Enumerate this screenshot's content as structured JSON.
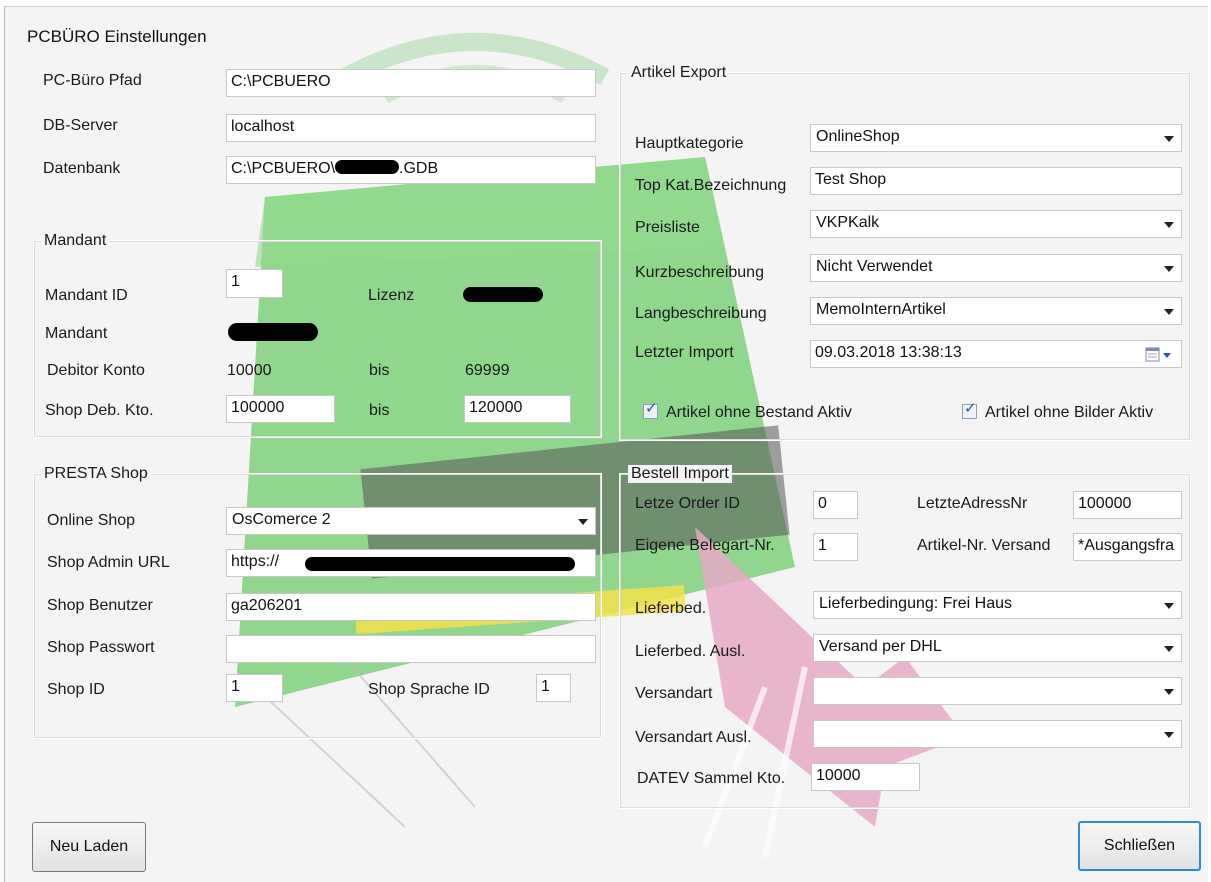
{
  "window": {
    "title": "PCBÜRO Einstellungen"
  },
  "paths": {
    "pcbuero_pfad_label": "PC-Büro Pfad",
    "pcbuero_pfad_value": "C:\\PCBUERO",
    "db_server_label": "DB-Server",
    "db_server_value": "localhost",
    "datenbank_label": "Datenbank",
    "datenbank_value_prefix": "C:\\PCBUERO\\",
    "datenbank_value_suffix": ".GDB"
  },
  "mandant": {
    "legend": "Mandant",
    "id_label": "Mandant ID",
    "id_value": "1",
    "lizenz_label": "Lizenz",
    "mandant_label": "Mandant",
    "debitor_label": "Debitor Konto",
    "debitor_from": "10000",
    "debitor_bis": "bis",
    "debitor_to": "69999",
    "shop_deb_label": "Shop Deb. Kto.",
    "shop_deb_from": "100000",
    "shop_deb_bis": "bis",
    "shop_deb_to": "120000"
  },
  "presta": {
    "legend": "PRESTA Shop",
    "online_shop_label": "Online Shop",
    "online_shop_value": "OsComerce 2",
    "admin_url_label": "Shop Admin URL",
    "admin_url_value": "https://",
    "benutzer_label": "Shop Benutzer",
    "benutzer_value": "ga206201",
    "passwort_label": "Shop Passwort",
    "passwort_value": "",
    "shop_id_label": "Shop ID",
    "shop_id_value": "1",
    "sprache_label": "Shop Sprache ID",
    "sprache_value": "1"
  },
  "export": {
    "legend": "Artikel Export",
    "hauptkategorie_label": "Hauptkategorie",
    "hauptkategorie_value": "OnlineShop",
    "topkat_label": "Top Kat.Bezeichnung",
    "topkat_value": "Test Shop",
    "preisliste_label": "Preisliste",
    "preisliste_value": "VKPKalk",
    "kurz_label": "Kurzbeschreibung",
    "kurz_value": "Nicht Verwendet",
    "lang_label": "Langbeschreibung",
    "lang_value": "MemoInternArtikel",
    "letzter_import_label": "Letzter Import",
    "letzter_import_value": "09.03.2018 13:38:13",
    "chk_bestand_label": "Artikel ohne Bestand Aktiv",
    "chk_bestand_checked": true,
    "chk_bilder_label": "Artikel ohne Bilder Aktiv",
    "chk_bilder_checked": true
  },
  "bestell": {
    "legend": "Bestell Import",
    "letze_order_label": "Letze Order ID",
    "letze_order_value": "0",
    "letzte_adress_label": "LetzteAdressNr",
    "letzte_adress_value": "100000",
    "belegart_label": "Eigene Belegart-Nr.",
    "belegart_value": "1",
    "artikel_versand_label": "Artikel-Nr. Versand",
    "artikel_versand_value": "*Ausgangsfra",
    "lieferbed_label": "Lieferbed.",
    "lieferbed_value": "Lieferbedingung: Frei Haus",
    "lieferbed_ausl_label": "Lieferbed. Ausl.",
    "lieferbed_ausl_value": "Versand per DHL",
    "versandart_label": "Versandart",
    "versandart_value": "",
    "versandart_ausl_label": "Versandart Ausl.",
    "versandart_ausl_value": "",
    "datev_label": "DATEV Sammel Kto.",
    "datev_value": "10000"
  },
  "buttons": {
    "neu_laden": "Neu Laden",
    "schliessen": "Schließen"
  },
  "colors": {
    "watermark_green": "#7fd07a",
    "watermark_pink": "#e6a9c4",
    "focus_blue": "#2f8ad8"
  }
}
